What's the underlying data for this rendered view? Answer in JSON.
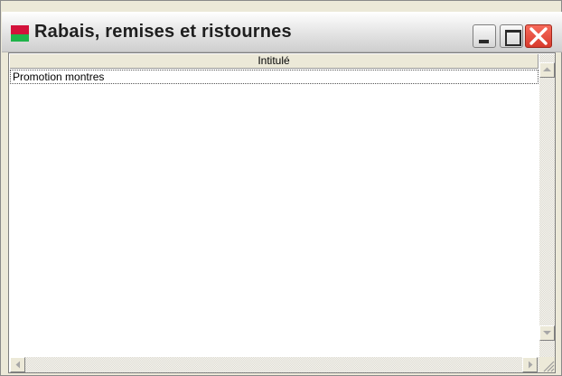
{
  "window": {
    "title": "Rabais, remises et ristournes",
    "icon": "app-flag-icon",
    "controls": [
      "minimize-icon",
      "maximize-icon",
      "close-icon"
    ]
  },
  "table": {
    "columns": [
      "Intitulé"
    ],
    "rows": [
      {
        "intitule": "Promotion montres"
      }
    ]
  },
  "colors": {
    "icon_red": "#d3123b",
    "icon_green": "#1fb34a",
    "close_red": "#e8503f"
  }
}
